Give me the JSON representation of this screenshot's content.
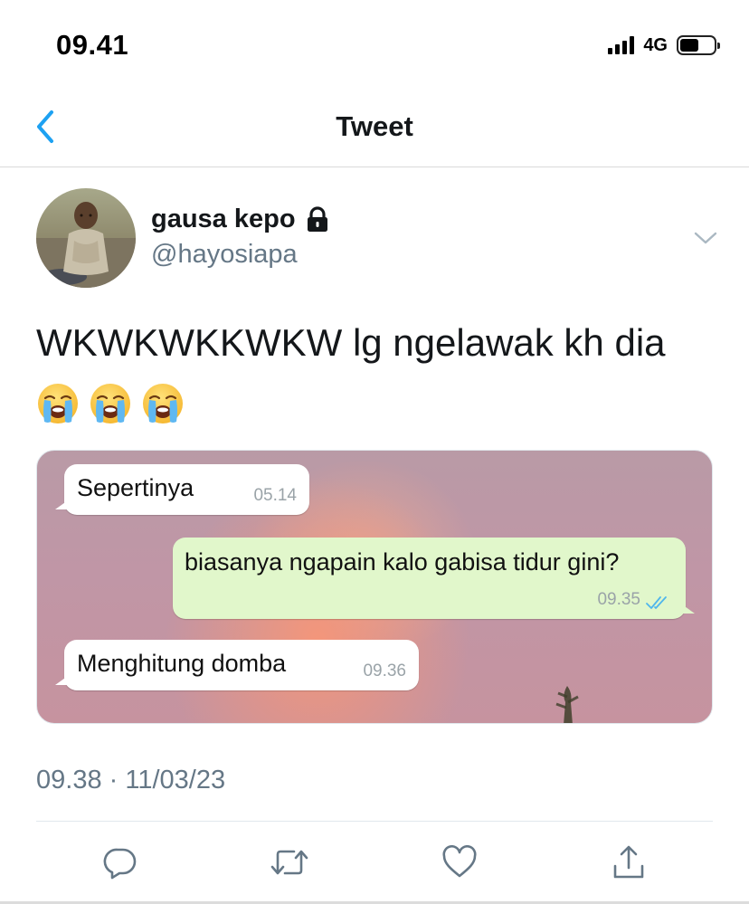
{
  "status_bar": {
    "time": "09.41",
    "network": "4G",
    "battery_level": 0.55
  },
  "nav": {
    "back_icon": "chevron-left-icon",
    "title": "Tweet",
    "accent_color": "#1da1f2"
  },
  "author": {
    "display_name": "gausa kepo",
    "protected_icon": "lock-icon",
    "handle": "@hayosiapa",
    "menu_icon": "chevron-down-icon"
  },
  "tweet": {
    "text": "WKWKWKKWKW lg ngelawak kh dia",
    "emojis": [
      "crying-face-emoji",
      "crying-face-emoji",
      "crying-face-emoji"
    ],
    "timestamp": "09.38 · 11/03/23"
  },
  "media": {
    "messages": [
      {
        "direction": "incoming",
        "text": "Sepertinya",
        "time": "05.14"
      },
      {
        "direction": "outgoing",
        "text": "biasanya ngapain kalo gabisa tidur gini?",
        "time": "09.35",
        "status_icon": "double-check-icon"
      },
      {
        "direction": "incoming",
        "text": "Menghitung domba",
        "time": "09.36"
      }
    ],
    "outgoing_bubble_color": "#e1f7cb"
  },
  "actions": [
    {
      "icon": "reply-icon"
    },
    {
      "icon": "retweet-icon"
    },
    {
      "icon": "like-icon"
    },
    {
      "icon": "share-icon"
    }
  ]
}
